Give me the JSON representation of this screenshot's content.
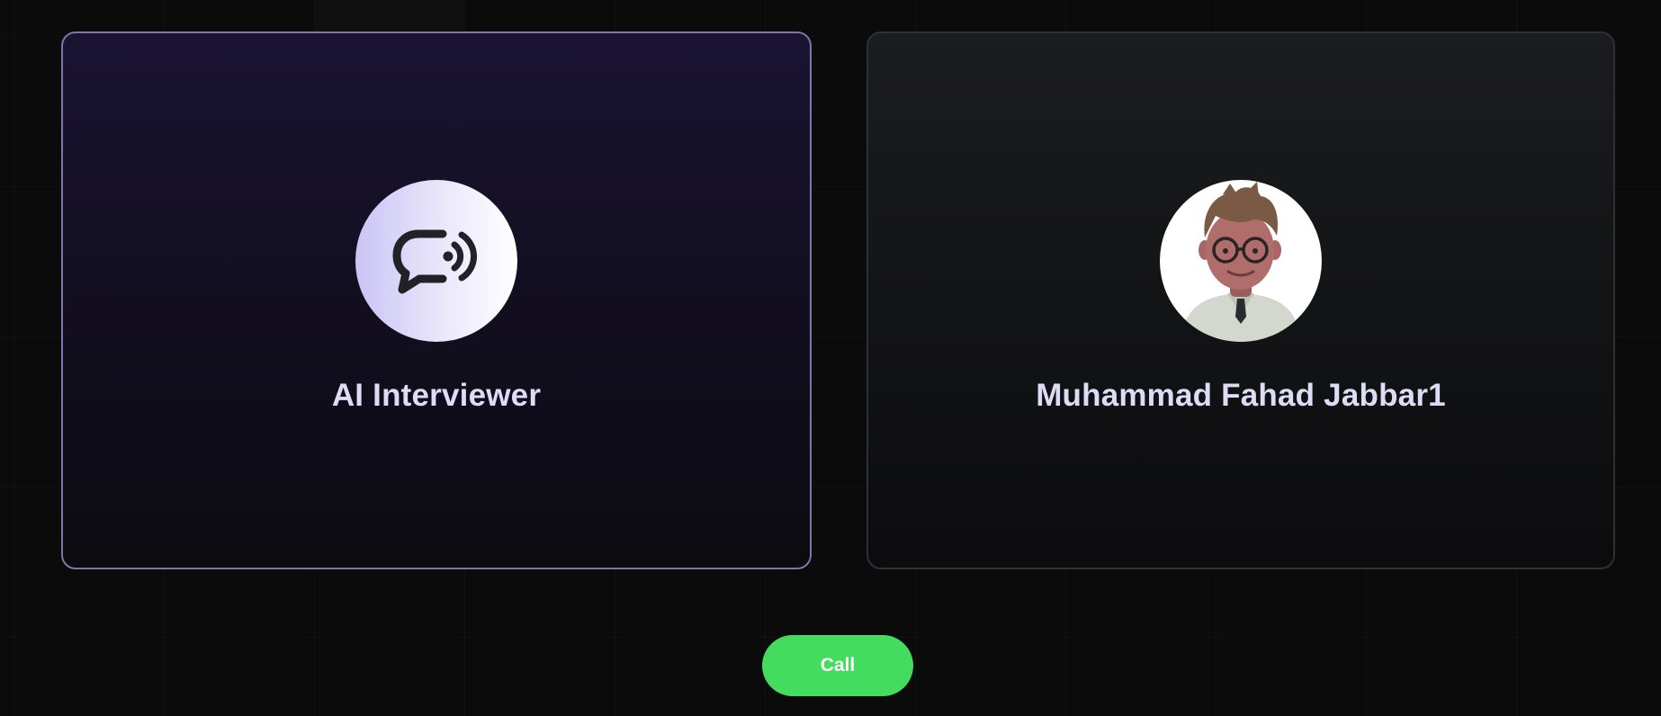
{
  "interviewer": {
    "name": "AI Interviewer",
    "icon": "chat-voice-icon"
  },
  "candidate": {
    "name": "Muhammad Fahad Jabbar1",
    "avatar": "user-avatar-icon"
  },
  "controls": {
    "call_label": "Call"
  },
  "colors": {
    "accent_green": "#43dc5e",
    "ai_card_border": "#7d76a6",
    "name_text": "#dcdcf7",
    "background": "#0b0b0c"
  }
}
